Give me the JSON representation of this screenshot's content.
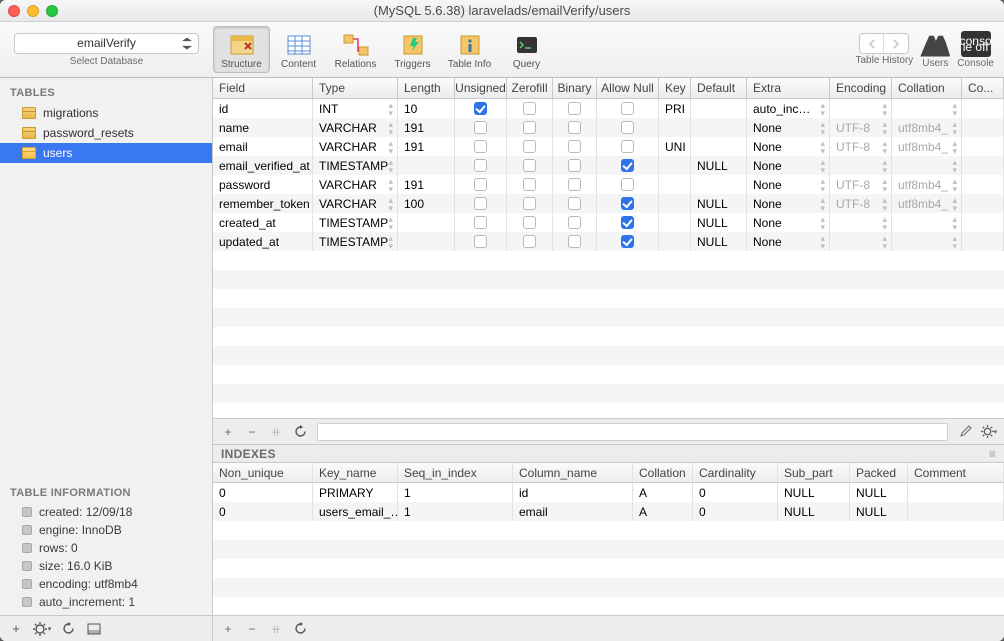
{
  "title": "(MySQL 5.6.38) laravelads/emailVerify/users",
  "selected_db": "emailVerify",
  "select_db_label": "Select Database",
  "toolbar": {
    "tabs": [
      "Structure",
      "Content",
      "Relations",
      "Triggers",
      "Table Info",
      "Query"
    ],
    "history": "Table History",
    "users": "Users",
    "console": "Console"
  },
  "sidebar": {
    "tables_hdr": "TABLES",
    "tables": [
      "migrations",
      "password_resets",
      "users"
    ],
    "selected": "users",
    "info_hdr": "TABLE INFORMATION",
    "info": [
      {
        "k": "created",
        "v": "12/09/18"
      },
      {
        "k": "engine",
        "v": "InnoDB"
      },
      {
        "k": "rows",
        "v": "0"
      },
      {
        "k": "size",
        "v": "16.0 KiB"
      },
      {
        "k": "encoding",
        "v": "utf8mb4"
      },
      {
        "k": "auto_increment",
        "v": "1"
      }
    ]
  },
  "columns": {
    "headers": [
      "Field",
      "Type",
      "Length",
      "Unsigned",
      "Zerofill",
      "Binary",
      "Allow Null",
      "Key",
      "Default",
      "Extra",
      "Encoding",
      "Collation",
      "Co..."
    ],
    "rows": [
      {
        "field": "id",
        "type": "INT",
        "len": "10",
        "uns": true,
        "zf": false,
        "bin": false,
        "an": false,
        "key": "PRI",
        "def": "",
        "extra": "auto_inc…",
        "enc": "",
        "coll": ""
      },
      {
        "field": "name",
        "type": "VARCHAR",
        "len": "191",
        "uns": false,
        "zf": false,
        "bin": false,
        "an": false,
        "key": "",
        "def": "",
        "extra": "None",
        "enc": "UTF-8",
        "coll": "utf8mb4_"
      },
      {
        "field": "email",
        "type": "VARCHAR",
        "len": "191",
        "uns": false,
        "zf": false,
        "bin": false,
        "an": false,
        "key": "UNI",
        "def": "",
        "extra": "None",
        "enc": "UTF-8",
        "coll": "utf8mb4_"
      },
      {
        "field": "email_verified_at",
        "type": "TIMESTAMP",
        "len": "",
        "uns": false,
        "zf": false,
        "bin": false,
        "an": true,
        "key": "",
        "def": "NULL",
        "extra": "None",
        "enc": "",
        "coll": ""
      },
      {
        "field": "password",
        "type": "VARCHAR",
        "len": "191",
        "uns": false,
        "zf": false,
        "bin": false,
        "an": false,
        "key": "",
        "def": "",
        "extra": "None",
        "enc": "UTF-8",
        "coll": "utf8mb4_"
      },
      {
        "field": "remember_token",
        "type": "VARCHAR",
        "len": "100",
        "uns": false,
        "zf": false,
        "bin": false,
        "an": true,
        "key": "",
        "def": "NULL",
        "extra": "None",
        "enc": "UTF-8",
        "coll": "utf8mb4_"
      },
      {
        "field": "created_at",
        "type": "TIMESTAMP",
        "len": "",
        "uns": false,
        "zf": false,
        "bin": false,
        "an": true,
        "key": "",
        "def": "NULL",
        "extra": "None",
        "enc": "",
        "coll": ""
      },
      {
        "field": "updated_at",
        "type": "TIMESTAMP",
        "len": "",
        "uns": false,
        "zf": false,
        "bin": false,
        "an": true,
        "key": "",
        "def": "NULL",
        "extra": "None",
        "enc": "",
        "coll": ""
      }
    ]
  },
  "indexes": {
    "hdr": "INDEXES",
    "headers": [
      "Non_unique",
      "Key_name",
      "Seq_in_index",
      "Column_name",
      "Collation",
      "Cardinality",
      "Sub_part",
      "Packed",
      "Comment"
    ],
    "rows": [
      {
        "nu": "0",
        "kn": "PRIMARY",
        "si": "1",
        "cn": "id",
        "col": "A",
        "card": "0",
        "sub": "NULL",
        "pack": "NULL",
        "com": ""
      },
      {
        "nu": "0",
        "kn": "users_email_…",
        "si": "1",
        "cn": "email",
        "col": "A",
        "card": "0",
        "sub": "NULL",
        "pack": "NULL",
        "com": ""
      }
    ]
  }
}
